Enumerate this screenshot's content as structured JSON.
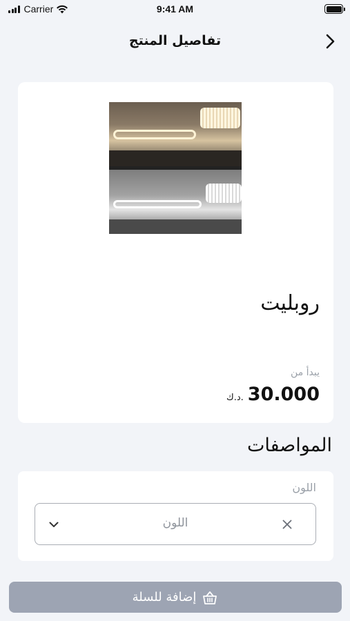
{
  "status_bar": {
    "carrier": "Carrier",
    "time": "9:41 AM"
  },
  "nav": {
    "title": "تفاصيل المنتج",
    "back_icon": "chevron-right-icon"
  },
  "product": {
    "name": "روبليت",
    "price_prefix": "يبدأ من",
    "price": "30.000",
    "currency": "د.ك."
  },
  "specs": {
    "title": "المواصفات",
    "color_label": "اللون",
    "color_placeholder": "اللون"
  },
  "actions": {
    "add_to_cart": "إضافة للسلة",
    "add_to_cart_icon": "basket-icon"
  },
  "colors": {
    "background": "#f2f4f8",
    "button_disabled": "#9da4b3",
    "muted_text": "#9aa0a8"
  }
}
